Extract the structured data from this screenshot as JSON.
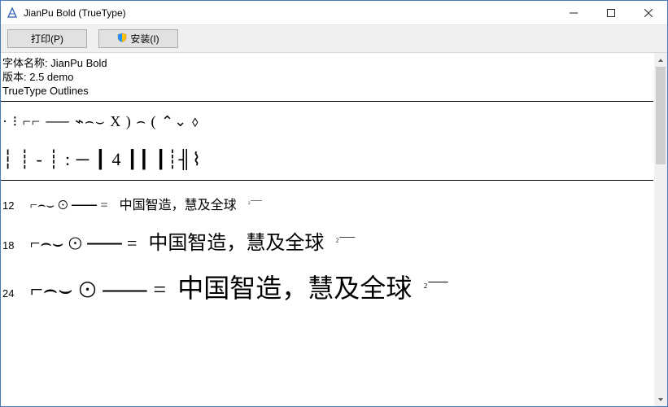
{
  "window": {
    "title": "JianPu Bold (TrueType)"
  },
  "toolbar": {
    "print_label": "打印(P)",
    "install_label": "安装(I)"
  },
  "meta": {
    "font_name_label": "字体名称:",
    "font_name": "JianPu Bold",
    "version_label": "版本:",
    "version": "2.5 demo",
    "outlines": "TrueType Outlines"
  },
  "glyph_preview": {
    "line1": "· ⁝ ⌐⌐  ⸺  ⌁⌢⌣  X  ) ⌢ (  ⌃⌄  ⬨",
    "line2": "┆ ┊ - ┊ :  ─   ┃ 4 ┃┃  ┃┊╢⌇ "
  },
  "samples": [
    {
      "size": "12",
      "symbols": "⌐⌢⌣ ⊙   ⸺  =",
      "sup": "₂⸺",
      "text": "中国智造，慧及全球"
    },
    {
      "size": "18",
      "symbols": "⌐⌢⌣ ⊙   ⸺  =",
      "sup": "₂⸺",
      "text": "中国智造，慧及全球"
    },
    {
      "size": "24",
      "symbols": "⌐⌢⌣ ⊙   ⸺  =",
      "sup": "₂⸺",
      "text": "中国智造，慧及全球"
    }
  ]
}
